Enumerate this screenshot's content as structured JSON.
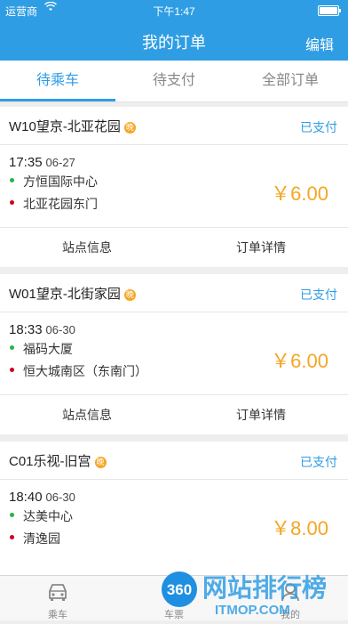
{
  "status_bar": {
    "carrier": "运营商",
    "time": "下午1:47"
  },
  "header": {
    "title": "我的订单",
    "edit_label": "编辑"
  },
  "tabs": [
    {
      "label": "待乘车"
    },
    {
      "label": "待支付"
    },
    {
      "label": "全部订单"
    }
  ],
  "orders": [
    {
      "route": "W10望京-北亚花园",
      "badge": "晚",
      "status": "已支付",
      "time": "17:35",
      "date": "06-27",
      "from": "方恒国际中心",
      "to": "北亚花园东门",
      "price": "￥6.00",
      "stations_label": "站点信息",
      "detail_label": "订单详情"
    },
    {
      "route": "W01望京-北街家园",
      "badge": "晚",
      "status": "已支付",
      "time": "18:33",
      "date": "06-30",
      "from": "福码大厦",
      "to": "恒大城南区（东南门）",
      "price": "￥6.00",
      "stations_label": "站点信息",
      "detail_label": "订单详情"
    },
    {
      "route": "C01乐视-旧宫",
      "badge": "晚",
      "status": "已支付",
      "time": "18:40",
      "date": "06-30",
      "from": "达美中心",
      "to": "清逸园",
      "price": "￥8.00"
    }
  ],
  "tabbar": [
    {
      "label": "乘车",
      "icon": "car-icon"
    },
    {
      "label": "车票",
      "icon": "ticket-icon"
    },
    {
      "label": "我的",
      "icon": "person-icon"
    }
  ],
  "watermark": {
    "text": "网站排行榜",
    "sub": "ITMOP.COM",
    "badge": "360"
  },
  "colors": {
    "primary": "#2f9de4",
    "price": "#f5a623",
    "night_badge": "#f6a623"
  }
}
